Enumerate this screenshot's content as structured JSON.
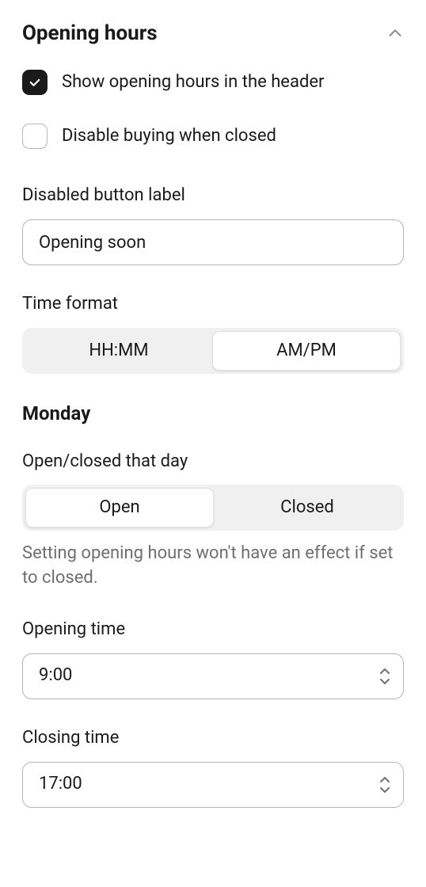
{
  "section": {
    "title": "Opening hours"
  },
  "checkboxes": {
    "show_header": {
      "label": "Show opening hours in the header",
      "checked": true
    },
    "disable_buying": {
      "label": "Disable buying when closed",
      "checked": false
    }
  },
  "fields": {
    "disabled_button_label": {
      "label": "Disabled button label",
      "value": "Opening soon"
    },
    "time_format": {
      "label": "Time format",
      "options": [
        "HH:MM",
        "AM/PM"
      ],
      "selected": "AM/PM"
    },
    "open_closed": {
      "label": "Open/closed that day",
      "options": [
        "Open",
        "Closed"
      ],
      "selected": "Open",
      "help": "Setting opening hours won't have an effect if set to closed."
    },
    "opening_time": {
      "label": "Opening time",
      "value": "9:00"
    },
    "closing_time": {
      "label": "Closing time",
      "value": "17:00"
    }
  },
  "day": "Monday"
}
